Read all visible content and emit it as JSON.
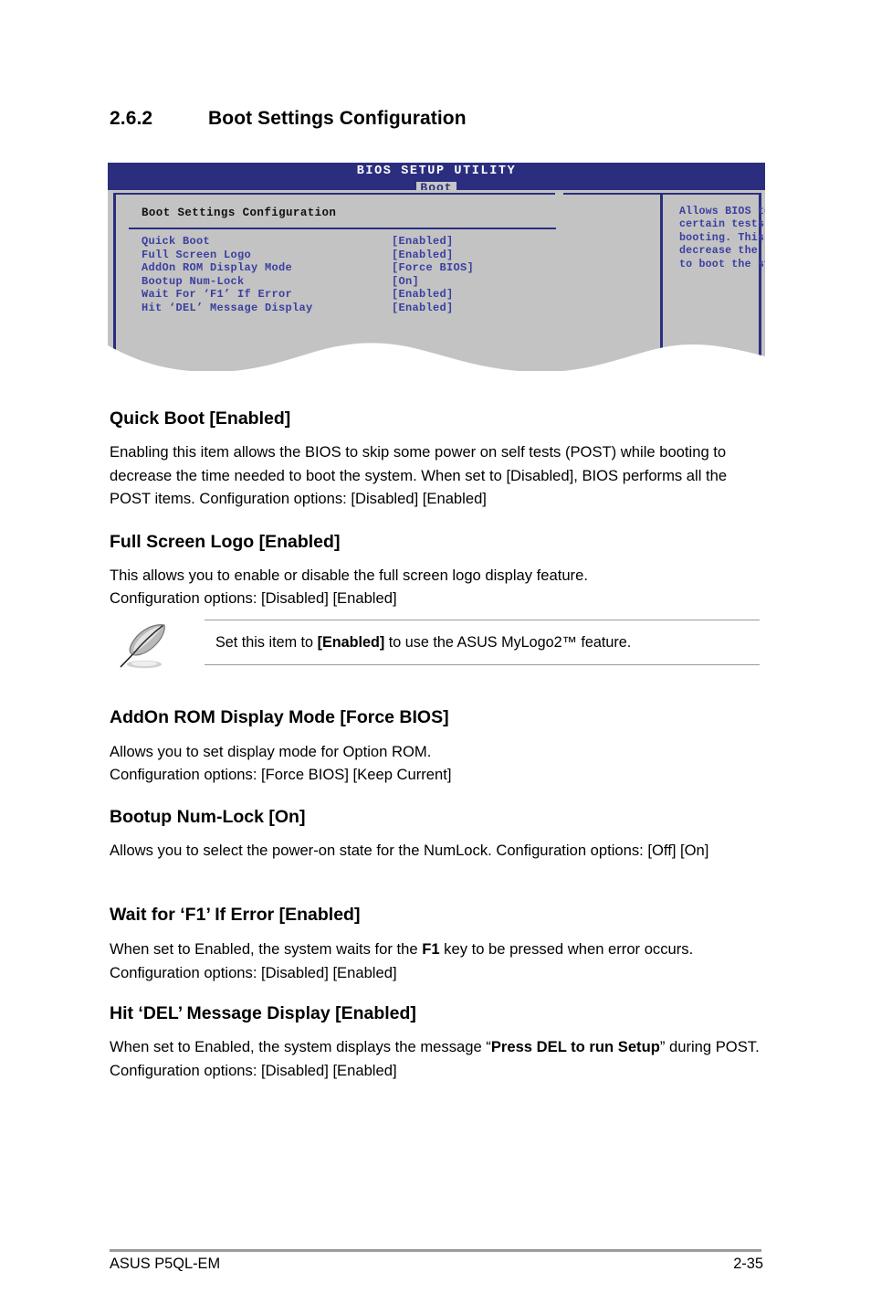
{
  "section": {
    "number": "2.6.2",
    "title": "Boot Settings Configuration"
  },
  "bios": {
    "title": "BIOS SETUP UTILITY",
    "tab": "Boot",
    "panel_heading": "Boot Settings Configuration",
    "items": [
      {
        "label": "Quick Boot",
        "value": "[Enabled]"
      },
      {
        "label": "Full Screen Logo",
        "value": "[Enabled]"
      },
      {
        "label": "AddOn ROM Display Mode",
        "value": "[Force BIOS]"
      },
      {
        "label": "Bootup Num-Lock",
        "value": "[On]"
      },
      {
        "label": "Wait For ‘F1’ If Error",
        "value": "[Enabled]"
      },
      {
        "label": "Hit ‘DEL’ Message Display",
        "value": "[Enabled]"
      }
    ],
    "help_text": "Allows BIOS to skip certain tests while booting. This will decrease the time needed to boot the system.",
    "colors": {
      "titlebar": "#2b2e7e",
      "panel_background": "#c3c3c3",
      "item_text": "#3a3fa0",
      "tab_background": "#c6c6c6"
    }
  },
  "sections": [
    {
      "heading": "Quick Boot [Enabled]",
      "body": "Enabling this item allows the BIOS to skip some power on self tests (POST) while booting to decrease the time needed to boot the system. When set to [Disabled], BIOS performs all the POST items. Configuration options: [Disabled] [Enabled]"
    },
    {
      "heading": "Full Screen Logo [Enabled]",
      "body_line1": "This allows you to enable or disable the full screen logo display feature.",
      "body_line2": "Configuration options: [Disabled] [Enabled]"
    },
    {
      "heading": "AddOn ROM Display Mode [Force BIOS]",
      "body_line1": "Allows you to set display mode for Option ROM.",
      "body_line2": "Configuration options: [Force BIOS] [Keep Current]"
    },
    {
      "heading": "Bootup Num-Lock [On]",
      "body": "Allows you to select the power-on state for the NumLock. Configuration options: [Off] [On]"
    },
    {
      "heading": "Wait for ‘F1’ If Error [Enabled]",
      "body_part1": "When set to Enabled, the system waits for the ",
      "body_bold": "F1",
      "body_part2": " key to be pressed when error occurs. Configuration options: [Disabled] [Enabled]"
    },
    {
      "heading": "Hit ‘DEL’ Message Display [Enabled]",
      "body_part1": "When set to Enabled, the system displays the message “",
      "body_bold": "Press DEL to run Setup",
      "body_part2": "” during POST. Configuration options: [Disabled] [Enabled]"
    }
  ],
  "note": {
    "icon": "quill-pen-icon",
    "text_part1": "Set this item to ",
    "text_bold": "[Enabled]",
    "text_part2": " to use the ASUS MyLogo2™ feature."
  },
  "footer": {
    "left": "ASUS P5QL-EM",
    "right": "2-35"
  }
}
